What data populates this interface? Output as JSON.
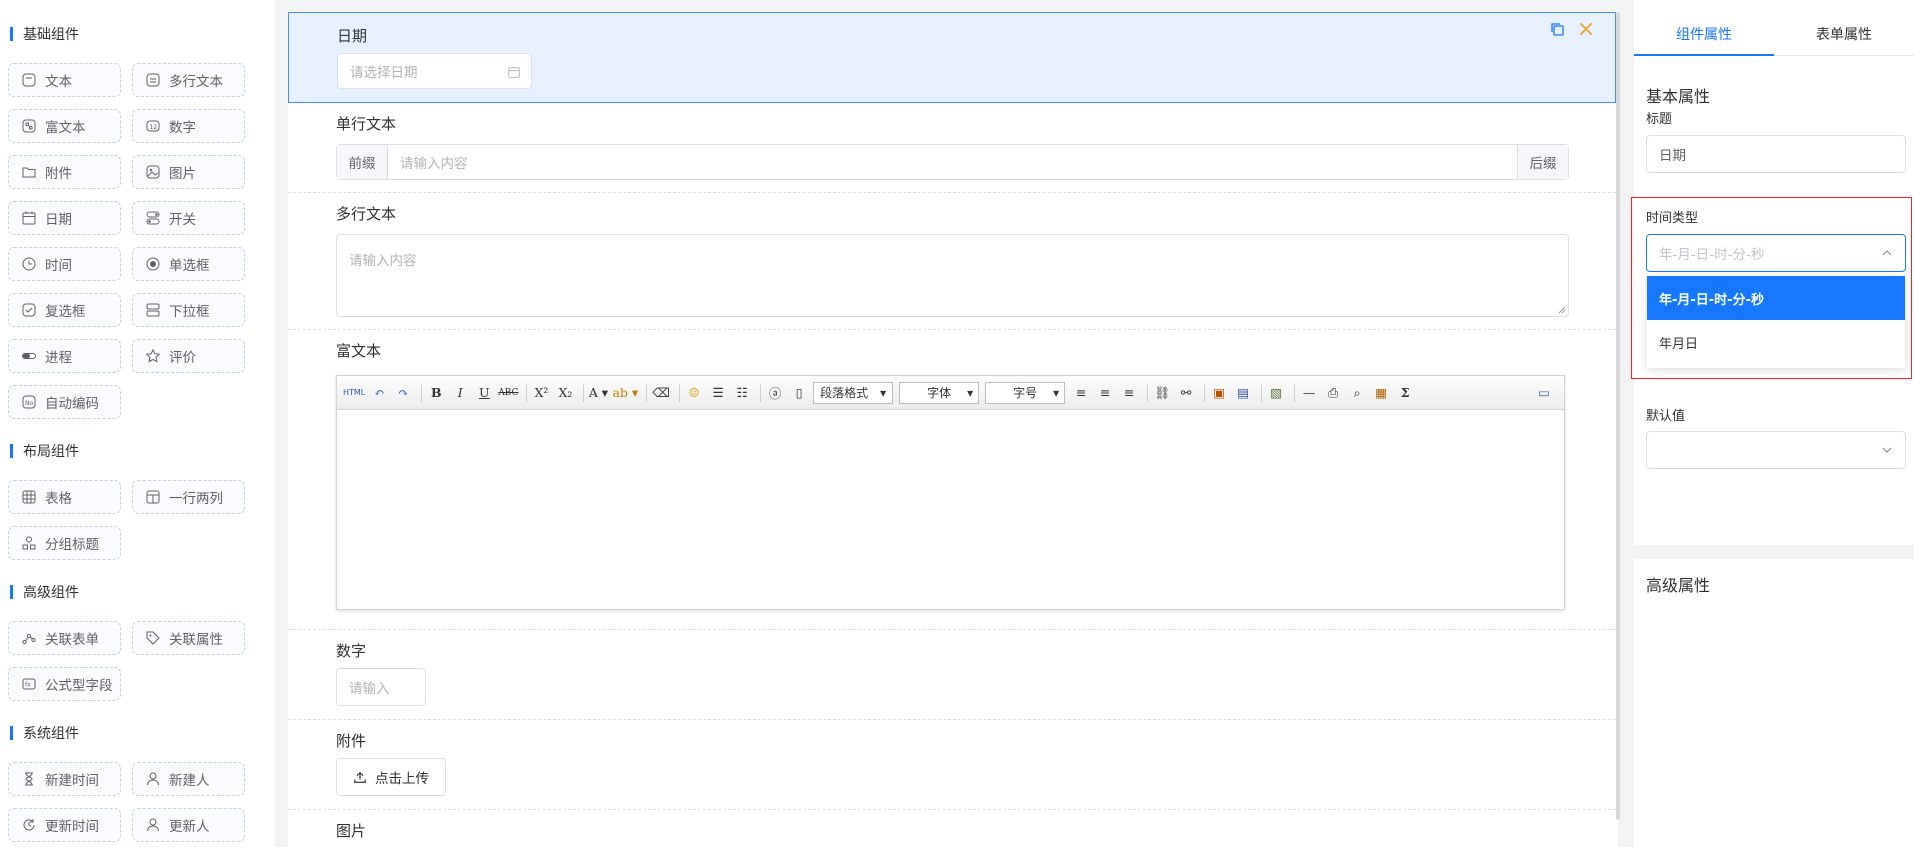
{
  "palette": {
    "sections": [
      {
        "title": "基础组件"
      },
      {
        "title": "布局组件"
      },
      {
        "title": "高级组件"
      },
      {
        "title": "系统组件"
      }
    ],
    "items": {
      "text": "文本",
      "textarea": "多行文本",
      "richtext": "富文本",
      "number": "数字",
      "attachment": "附件",
      "image": "图片",
      "date": "日期",
      "switch": "开关",
      "time": "时间",
      "radio": "单选框",
      "checkbox": "复选框",
      "select": "下拉框",
      "progress": "进程",
      "rating": "评价",
      "autocode": "自动编码",
      "table": "表格",
      "two_cols": "一行两列",
      "group_title": "分组标题",
      "related_form": "关联表单",
      "related_attr": "关联属性",
      "formula": "公式型字段",
      "create_time": "新建时间",
      "creator": "新建人",
      "update_time": "更新时间",
      "updater": "更新人"
    }
  },
  "canvas": {
    "date": {
      "label": "日期",
      "placeholder": "请选择日期"
    },
    "text": {
      "label": "单行文本",
      "prefix": "前缀",
      "placeholder": "请输入内容",
      "suffix": "后缀"
    },
    "textarea": {
      "label": "多行文本",
      "placeholder": "请输入内容"
    },
    "richtext": {
      "label": "富文本",
      "toolbar": {
        "html": "HTML",
        "paragraph": "段落格式",
        "font": "字体",
        "size": "字号"
      }
    },
    "number": {
      "label": "数字",
      "placeholder": "请输入"
    },
    "attachment": {
      "label": "附件",
      "button": "点击上传"
    },
    "image": {
      "label": "图片"
    }
  },
  "panel": {
    "tabs": [
      "组件属性",
      "表单属性"
    ],
    "basic_title": "基本属性",
    "title_label": "标题",
    "title_value": "日期",
    "time_type_label": "时间类型",
    "time_type_placeholder": "年-月-日-时-分-秒",
    "time_type_options": [
      "年-月-日-时-分-秒",
      "年月日"
    ],
    "default_label": "默认值",
    "advanced_title": "高级属性"
  },
  "colors": {
    "accent": "#1677ff",
    "selected_bg": "#e7f0fe",
    "highlight": "#f5222d"
  }
}
